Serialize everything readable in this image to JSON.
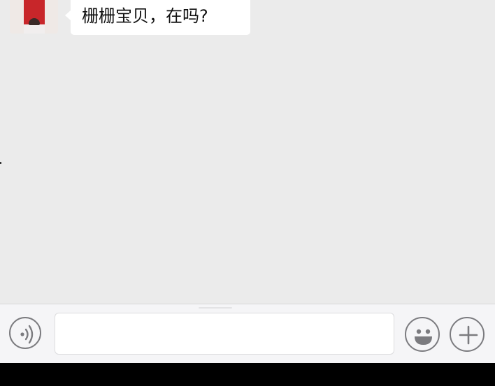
{
  "chat": {
    "messages": [
      {
        "sender": "other",
        "text": "栅栅宝贝，在吗?"
      }
    ]
  },
  "input_bar": {
    "input_value": "",
    "input_placeholder": "",
    "icons": {
      "voice": "voice-icon",
      "emoji": "emoji-icon",
      "more": "plus-icon"
    }
  },
  "colors": {
    "chat_background": "#ebebeb",
    "bubble_background": "#ffffff",
    "input_bar_background": "#f5f5f7",
    "icon_stroke": "#7b7b7f"
  }
}
